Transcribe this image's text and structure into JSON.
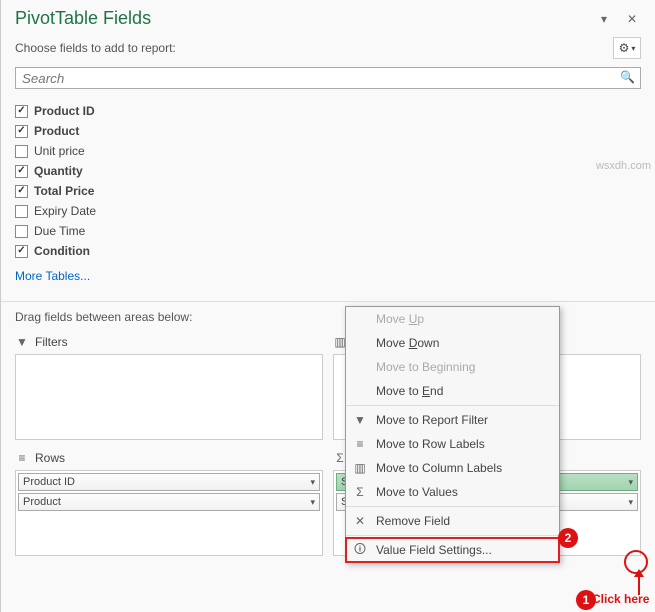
{
  "header": {
    "title": "PivotTable Fields"
  },
  "sub": {
    "label": "Choose fields to add to report:"
  },
  "search": {
    "placeholder": "Search"
  },
  "fields": [
    {
      "label": "Product ID",
      "checked": true
    },
    {
      "label": "Product",
      "checked": true
    },
    {
      "label": "Unit price",
      "checked": false
    },
    {
      "label": "Quantity",
      "checked": true
    },
    {
      "label": "Total Price",
      "checked": true
    },
    {
      "label": "Expiry Date",
      "checked": false
    },
    {
      "label": "Due Time",
      "checked": false
    },
    {
      "label": "Condition",
      "checked": true
    }
  ],
  "more": {
    "label": "More Tables..."
  },
  "drag": {
    "label": "Drag fields between areas below:"
  },
  "areas": {
    "filters": {
      "label": "Filters"
    },
    "columns": {
      "label": "Columns"
    },
    "rows": {
      "label": "Rows",
      "items": [
        "Product ID",
        "Product"
      ]
    },
    "values": {
      "label": "Values",
      "items": [
        "Sum of Quantity",
        "Sum of Total Price"
      ]
    }
  },
  "ctx": {
    "moveUp": "Move Up",
    "moveDown": "Move Down",
    "moveBeg": "Move to Beginning",
    "moveEnd": "Move to End",
    "toReport": "Move to Report Filter",
    "toRow": "Move to Row Labels",
    "toCol": "Move to Column Labels",
    "toVal": "Move to Values",
    "remove": "Remove Field",
    "vfs": "Value Field Settings..."
  },
  "annot": {
    "click": "Click here"
  },
  "watermark": "wsxdh.com"
}
